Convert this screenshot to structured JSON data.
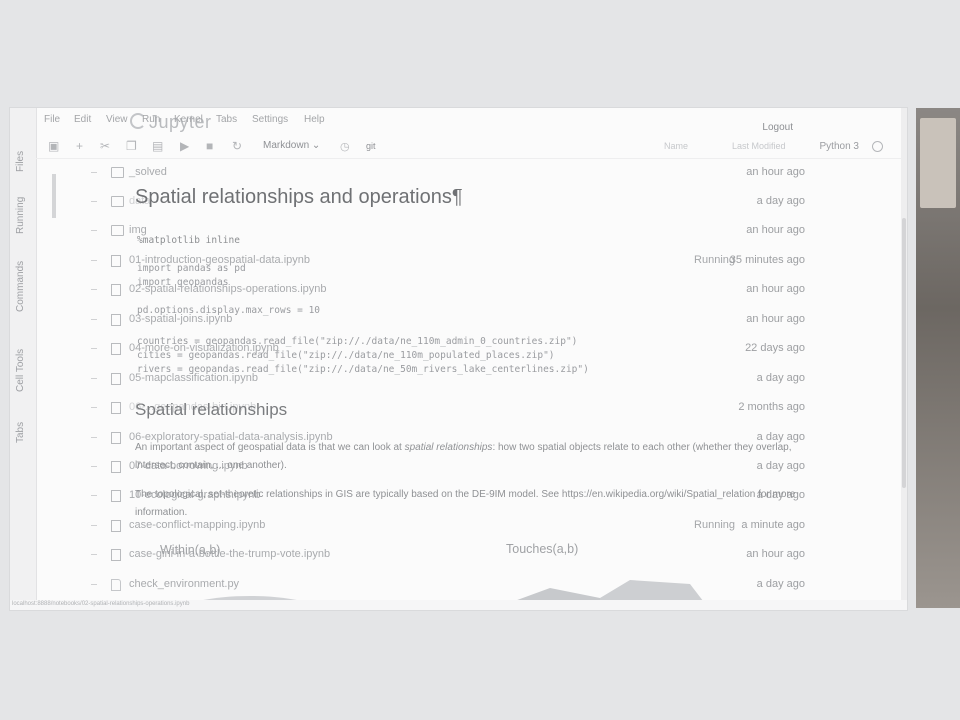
{
  "app": {
    "brand": "Jupyter",
    "logout_label": "Logout"
  },
  "menu": [
    "File",
    "Edit",
    "View",
    "Run",
    "Kernel",
    "Tabs",
    "Settings",
    "Help"
  ],
  "left_tabs": [
    "Files",
    "Running",
    "Commands",
    "Cell Tools",
    "Tabs"
  ],
  "toolbar": {
    "cell_type": "Markdown",
    "git_label": "git",
    "kernel_name": "Python 3",
    "header_name": "Name",
    "header_modified": "Last Modified"
  },
  "files": [
    {
      "name": "_solved",
      "kind": "folder",
      "status": "",
      "modified": "an hour ago"
    },
    {
      "name": "data",
      "kind": "folder",
      "status": "",
      "modified": "a day ago"
    },
    {
      "name": "img",
      "kind": "folder",
      "status": "",
      "modified": "an hour ago"
    },
    {
      "name": "01-introduction-geospatial-data.ipynb",
      "kind": "notebook",
      "status": "Running",
      "modified": "35 minutes ago"
    },
    {
      "name": "02-spatial-relationships-operations.ipynb",
      "kind": "notebook",
      "status": "",
      "modified": "an hour ago"
    },
    {
      "name": "03-spatial-joins.ipynb",
      "kind": "notebook",
      "status": "",
      "modified": "an hour ago"
    },
    {
      "name": "04-more-on-visualization.ipynb",
      "kind": "notebook",
      "status": "",
      "modified": "22 days ago"
    },
    {
      "name": "05-mapclassification.ipynb",
      "kind": "notebook",
      "status": "",
      "modified": "a day ago"
    },
    {
      "name": "06-...geopandas-bin.ipynb",
      "kind": "notebook",
      "status": "",
      "modified": "2 months ago"
    },
    {
      "name": "06-exploratory-spatial-data-analysis.ipynb",
      "kind": "notebook",
      "status": "",
      "modified": "a day ago"
    },
    {
      "name": "07-data-borrowing.ipynb",
      "kind": "notebook",
      "status": "",
      "modified": "a day ago"
    },
    {
      "name": "10-ecological-graphs.ipynb",
      "kind": "notebook",
      "status": "",
      "modified": "a day ago"
    },
    {
      "name": "case-conflict-mapping.ipynb",
      "kind": "notebook",
      "status": "Running",
      "modified": "a minute ago"
    },
    {
      "name": "case-gini-in-a-bottle-the-trump-vote.ipynb",
      "kind": "notebook",
      "status": "",
      "modified": "an hour ago"
    },
    {
      "name": "check_environment.py",
      "kind": "python",
      "status": "",
      "modified": "a day ago"
    }
  ],
  "notebook": {
    "title": "Spatial relationships and operations¶",
    "code": [
      "%matplotlib inline",
      "import pandas as pd",
      "import geopandas",
      "pd.options.display.max_rows = 10",
      "countries = geopandas.read_file(\"zip://./data/ne_110m_admin_0_countries.zip\")",
      "cities = geopandas.read_file(\"zip://./data/ne_110m_populated_places.zip\")",
      "rivers = geopandas.read_file(\"zip://./data/ne_50m_rivers_lake_centerlines.zip\")"
    ],
    "section_title": "Spatial relationships",
    "para1_a": "An important aspect of geospatial data is that we can look at ",
    "para1_em": "spatial relationships",
    "para1_b": ": how two spatial objects relate to each other (whether they overlap,",
    "para2": "intersect, contain, ... one another).",
    "para3": "The topological, set-theoretic relationships in GIS are typically based on the DE-9IM model. See https://en.wikipedia.org/wiki/Spatial_relation for more",
    "para4": "information.",
    "label_within": "Within(a,b)",
    "label_touches": "Touches(a,b)"
  },
  "status_url": "localhost:8888/notebooks/02-spatial-relationships-operations.ipynb"
}
